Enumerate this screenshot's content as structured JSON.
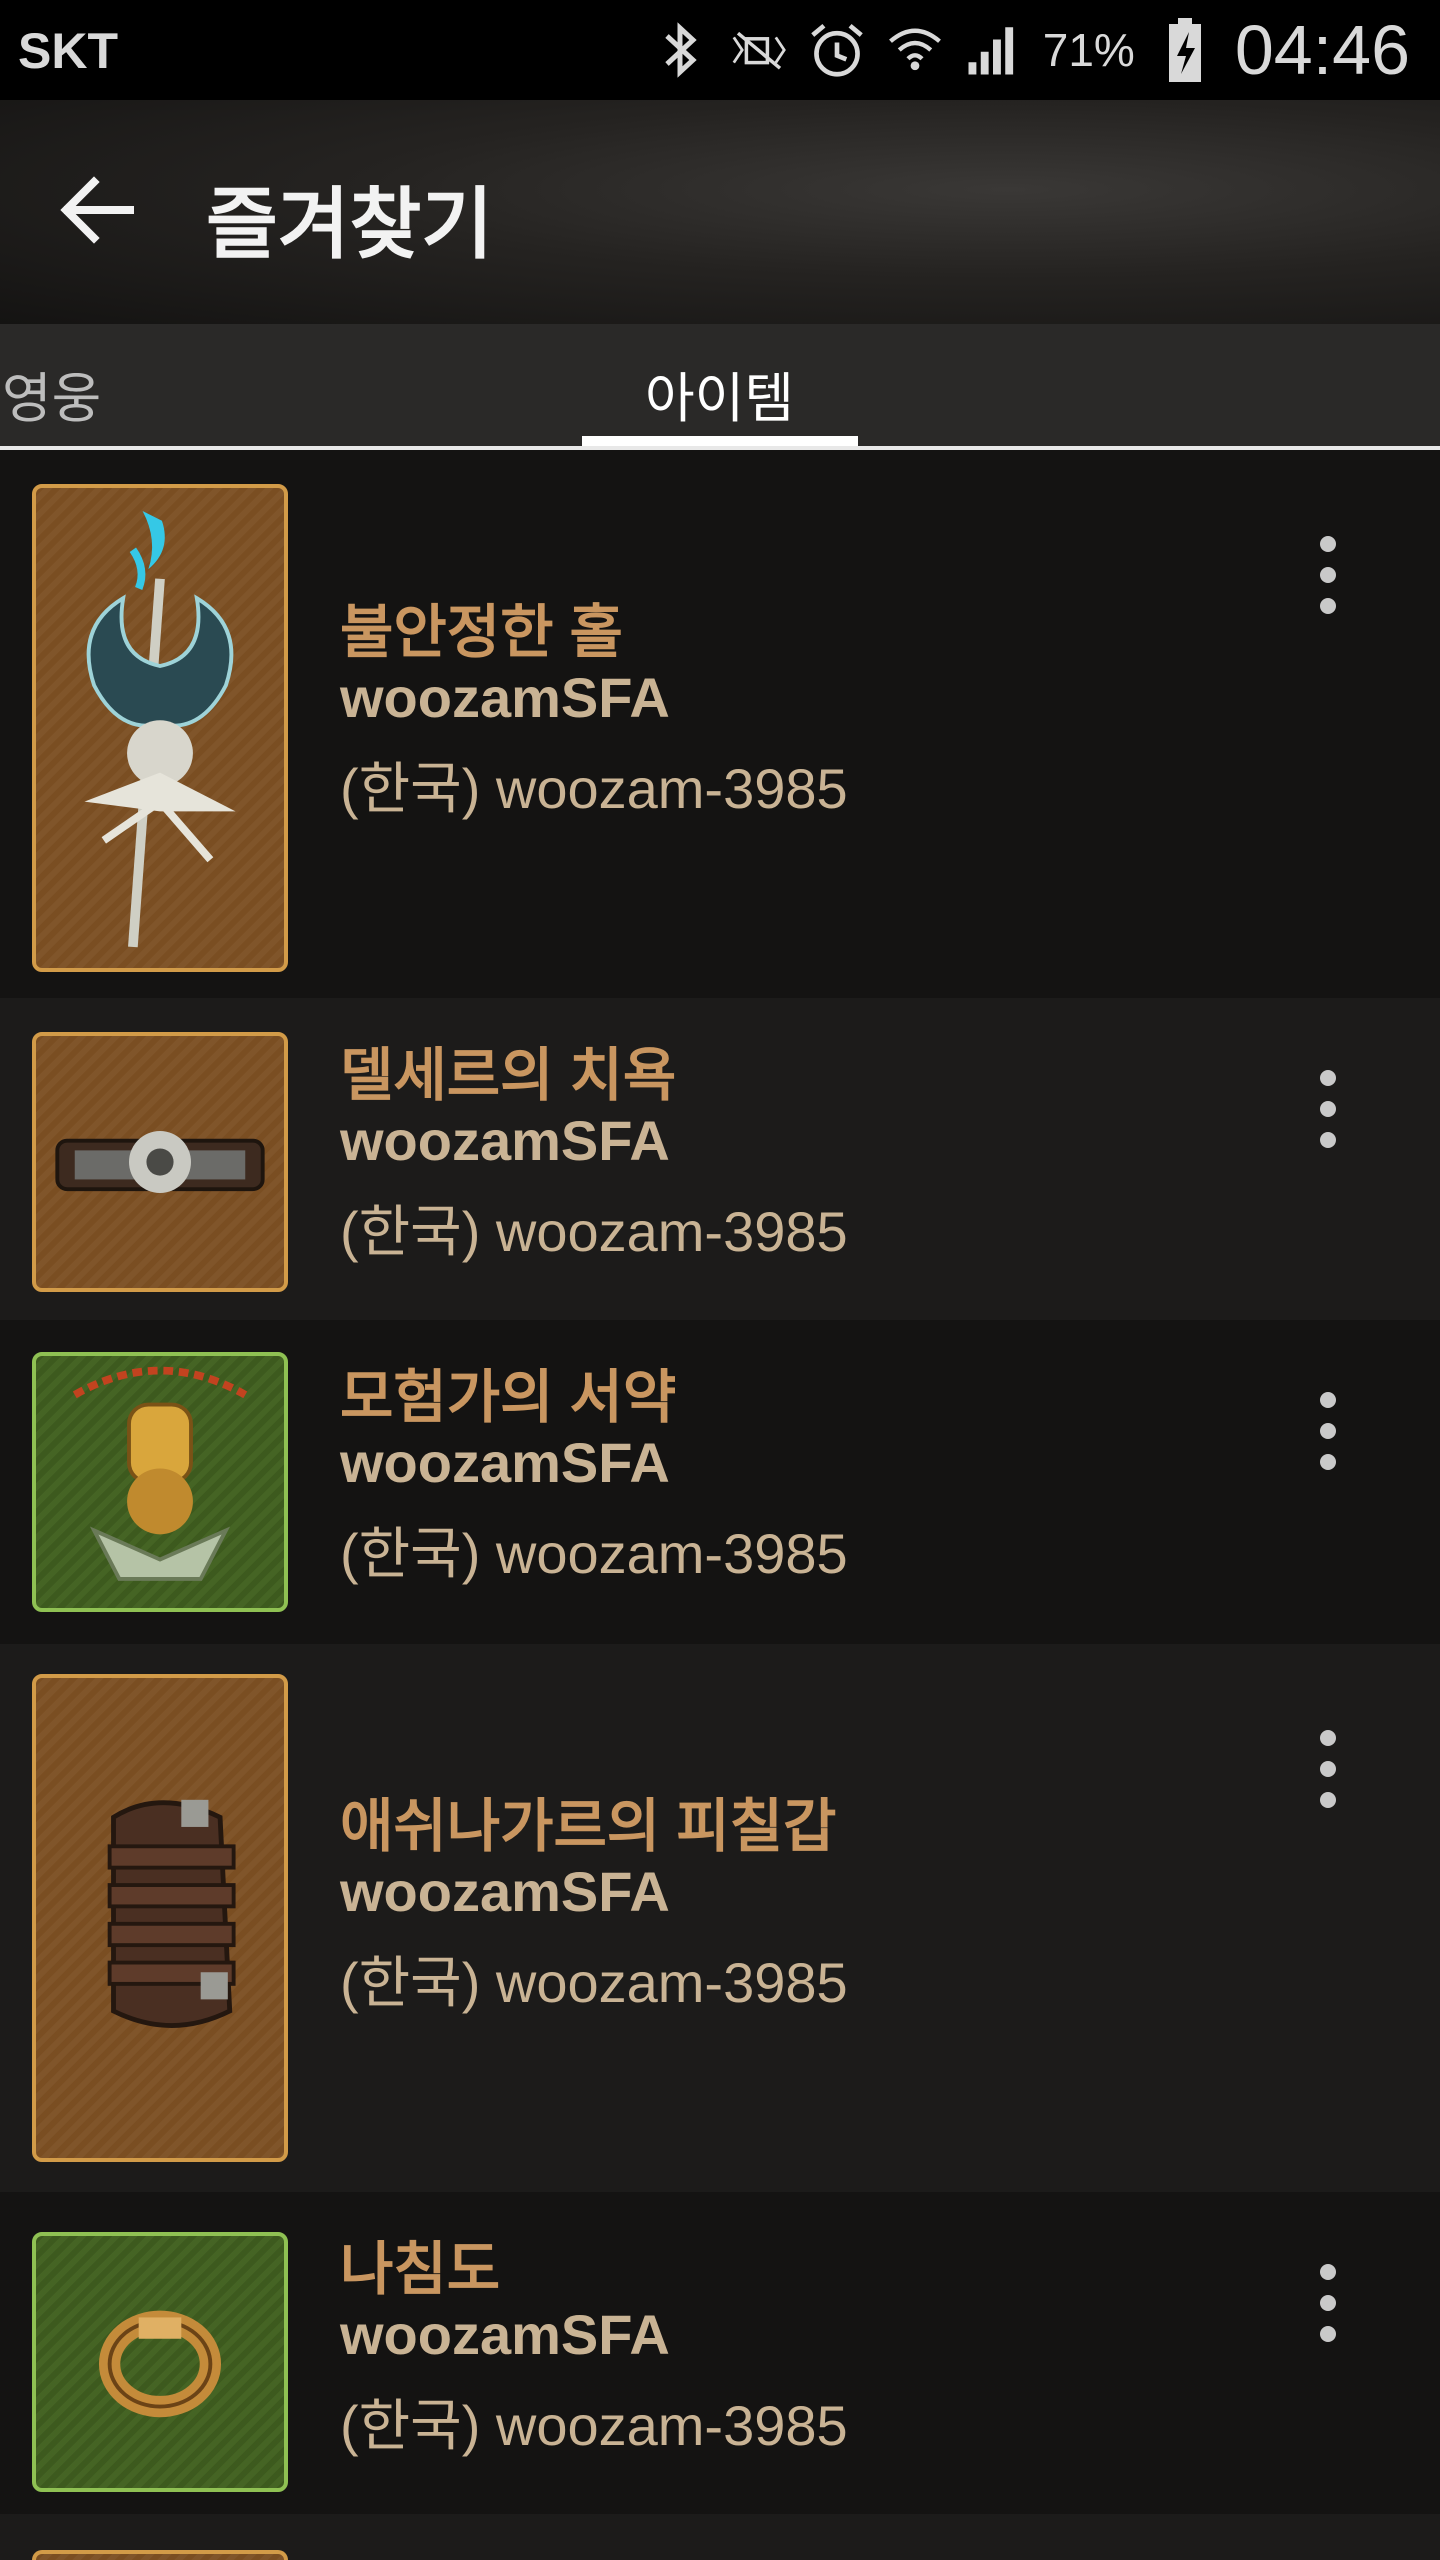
{
  "status_bar": {
    "carrier": "SKT",
    "battery": "71%",
    "time": "04:46",
    "icons": [
      "bluetooth-icon",
      "mute-icon",
      "alarm-icon",
      "wifi-icon",
      "signal-icon",
      "battery-icon"
    ]
  },
  "app_bar": {
    "title": "즐겨찾기",
    "back_icon": "back-arrow-icon"
  },
  "tabs": [
    {
      "label": "영웅",
      "active": false
    },
    {
      "label": "아이템",
      "active": true
    }
  ],
  "items": [
    {
      "name": "불안정한 홀",
      "battletag": "woozamSFA",
      "realm": "(한국) woozam-3985",
      "icon": "scepter-icon",
      "rarity_color": "#d29b48"
    },
    {
      "name": "델세르의 치욕",
      "battletag": "woozamSFA",
      "realm": "(한국) woozam-3985",
      "icon": "belt-icon",
      "rarity_color": "#d29b48"
    },
    {
      "name": "모험가의 서약",
      "battletag": "woozamSFA",
      "realm": "(한국) woozam-3985",
      "icon": "amulet-icon",
      "rarity_color": "#8fc153"
    },
    {
      "name": "애쉬나가르의 피칠갑",
      "battletag": "woozamSFA",
      "realm": "(한국) woozam-3985",
      "icon": "bracers-icon",
      "rarity_color": "#d29b48"
    },
    {
      "name": "나침도",
      "battletag": "woozamSFA",
      "realm": "(한국) woozam-3985",
      "icon": "ring-icon",
      "rarity_color": "#8fc153"
    }
  ],
  "colors": {
    "legendary": "#d29b48",
    "set": "#8fc153",
    "item_name": "#c99660"
  }
}
